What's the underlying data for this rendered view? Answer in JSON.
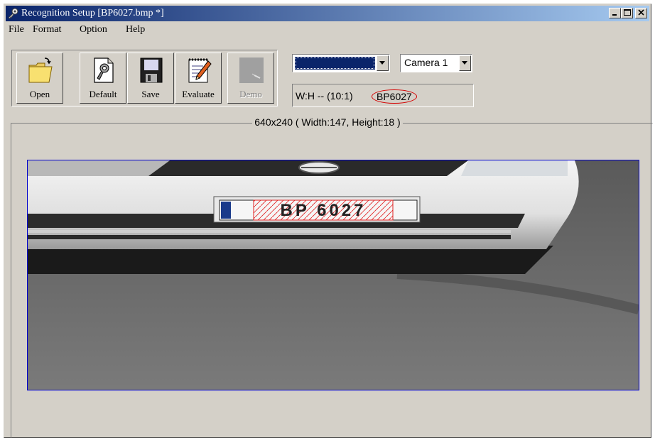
{
  "window": {
    "title": "Recognition Setup [BP6027.bmp *]",
    "title_icon": "key-icon"
  },
  "menu": [
    "File",
    "Format",
    "Option",
    "Help"
  ],
  "toolbar": {
    "buttons": [
      {
        "label": "Open",
        "icon": "folder-icon",
        "enabled": true
      },
      {
        "label": "Default",
        "icon": "wrench-document-icon",
        "enabled": true
      },
      {
        "label": "Save",
        "icon": "floppy-disk-icon",
        "enabled": true
      },
      {
        "label": "Evaluate",
        "icon": "notepad-pencil-icon",
        "enabled": true
      },
      {
        "label": "Demo",
        "icon": "demo-icon",
        "enabled": false
      }
    ]
  },
  "color_select": {
    "value_color": "#0a246a"
  },
  "camera_select": {
    "value": "Camera 1"
  },
  "info": {
    "ratio": "W:H -- (10:1)",
    "plate": "BP6027"
  },
  "image_panel": {
    "caption": "640x240 ( Width:147, Height:18 )",
    "plate_text": "BP 6027"
  },
  "colors": {
    "face": "#d4d0c8",
    "title_start": "#0a246a",
    "title_end": "#a6caf0",
    "frame_border": "#0000cc",
    "highlight_red": "#d40000"
  }
}
